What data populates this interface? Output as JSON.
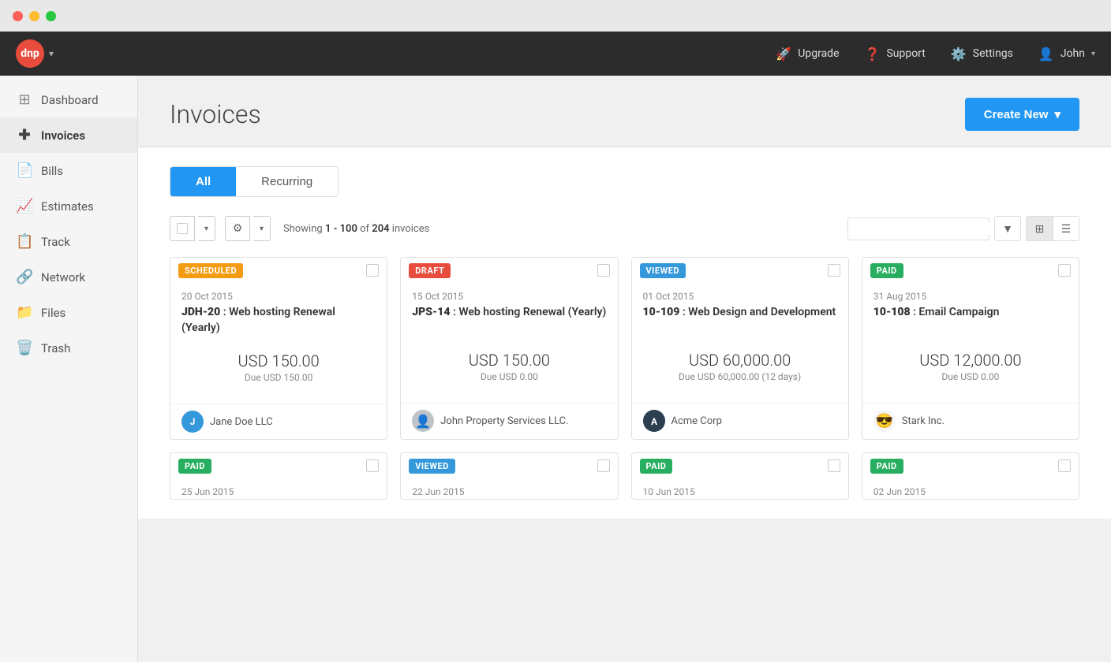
{
  "titleBar": {
    "buttons": [
      "close",
      "minimize",
      "maximize"
    ]
  },
  "topNav": {
    "logo": "dnp",
    "items": [
      {
        "id": "upgrade",
        "icon": "🚀",
        "label": "Upgrade"
      },
      {
        "id": "support",
        "icon": "❓",
        "label": "Support"
      },
      {
        "id": "settings",
        "icon": "⚙️",
        "label": "Settings"
      },
      {
        "id": "user",
        "icon": "👤",
        "label": "John"
      }
    ]
  },
  "sidebar": {
    "items": [
      {
        "id": "dashboard",
        "icon": "📊",
        "label": "Dashboard",
        "active": false
      },
      {
        "id": "invoices",
        "icon": "➕",
        "label": "Invoices",
        "active": true
      },
      {
        "id": "bills",
        "icon": "📄",
        "label": "Bills",
        "active": false
      },
      {
        "id": "estimates",
        "icon": "📈",
        "label": "Estimates",
        "active": false
      },
      {
        "id": "track",
        "icon": "📋",
        "label": "Track",
        "active": false
      },
      {
        "id": "network",
        "icon": "🔗",
        "label": "Network",
        "active": false
      },
      {
        "id": "files",
        "icon": "📁",
        "label": "Files",
        "active": false
      },
      {
        "id": "trash",
        "icon": "🗑️",
        "label": "Trash",
        "active": false
      }
    ]
  },
  "page": {
    "title": "Invoices",
    "createNewLabel": "Create New",
    "tabs": [
      {
        "id": "all",
        "label": "All",
        "active": true
      },
      {
        "id": "recurring",
        "label": "Recurring",
        "active": false
      }
    ],
    "toolbar": {
      "showingText": "Showing",
      "rangeStart": "1 - 100",
      "rangeMid": "of",
      "total": "204",
      "invoicesLabel": "invoices",
      "searchPlaceholder": "",
      "gridViewLabel": "Grid view",
      "listViewLabel": "List view"
    },
    "invoices": [
      {
        "status": "SCHEDULED",
        "statusClass": "status-scheduled",
        "date": "20 Oct 2015",
        "id": "JDH-20",
        "description": "Web hosting Renewal (Yearly)",
        "amount": "USD 150.00",
        "due": "Due USD 150.00",
        "clientName": "Jane Doe LLC",
        "clientInitial": "J",
        "avatarClass": "avatar-blue"
      },
      {
        "status": "DRAFT",
        "statusClass": "status-draft",
        "date": "15 Oct 2015",
        "id": "JPS-14",
        "description": "Web hosting Renewal (Yearly)",
        "amount": "USD 150.00",
        "due": "Due USD 0.00",
        "clientName": "John Property Services LLC.",
        "clientInitial": "👤",
        "avatarClass": "avatar-gray"
      },
      {
        "status": "VIEWED",
        "statusClass": "status-viewed",
        "date": "01 Oct 2015",
        "id": "10-109",
        "description": "Web Design and Development",
        "amount": "USD 60,000.00",
        "due": "Due USD 60,000.00 (12 days)",
        "clientName": "Acme Corp",
        "clientInitial": "A",
        "avatarClass": "avatar-dark"
      },
      {
        "status": "PAID",
        "statusClass": "status-paid",
        "date": "31 Aug 2015",
        "id": "10-108",
        "description": "Email Campaign",
        "amount": "USD 12,000.00",
        "due": "Due USD 0.00",
        "clientName": "Stark Inc.",
        "clientInitial": "😎",
        "avatarClass": "avatar-emoji"
      }
    ],
    "bottomInvoices": [
      {
        "status": "PAID",
        "statusClass": "status-paid",
        "date": "25 Jun 2015"
      },
      {
        "status": "VIEWED",
        "statusClass": "status-viewed",
        "date": "22 Jun 2015"
      },
      {
        "status": "PAID",
        "statusClass": "status-paid",
        "date": "10 Jun 2015"
      },
      {
        "status": "PAID",
        "statusClass": "status-paid",
        "date": "02 Jun 2015"
      }
    ]
  }
}
